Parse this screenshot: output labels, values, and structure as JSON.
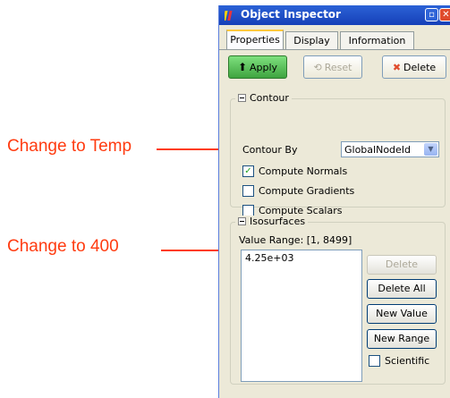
{
  "annotations": {
    "note1": "Change to Temp",
    "note2": "Change to 400",
    "color": "#ff3b10"
  },
  "window": {
    "title": "Object Inspector"
  },
  "tabs": [
    {
      "label": "Properties",
      "active": true
    },
    {
      "label": "Display",
      "active": false
    },
    {
      "label": "Information",
      "active": false
    }
  ],
  "toolbar": {
    "apply": "Apply",
    "reset": "Reset",
    "delete": "Delete"
  },
  "contour": {
    "legend": "Contour",
    "contour_by_label": "Contour By",
    "contour_by_value": "GlobalNodeId",
    "compute_normals": {
      "label": "Compute Normals",
      "checked": true
    },
    "compute_gradients": {
      "label": "Compute Gradients",
      "checked": false
    },
    "compute_scalars": {
      "label": "Compute Scalars",
      "checked": false
    }
  },
  "isosurfaces": {
    "legend": "Isosurfaces",
    "value_range": "Value Range: [1, 8499]",
    "values": [
      "4.25e+03"
    ],
    "delete": "Delete",
    "delete_all": "Delete All",
    "new_value": "New Value",
    "new_range": "New Range",
    "scientific": {
      "label": "Scientific",
      "checked": false
    }
  },
  "checkmark": "✓",
  "dropdown_arrow": "▼"
}
